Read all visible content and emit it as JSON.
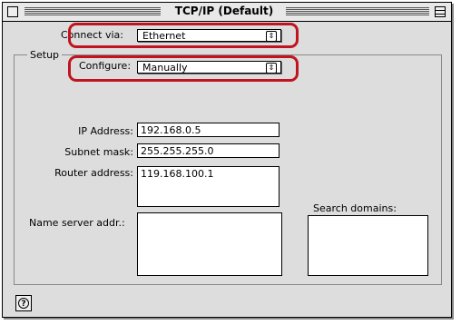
{
  "window": {
    "title": "TCP/IP (Default)"
  },
  "connect_via": {
    "label": "Connect via:",
    "value": "Ethernet"
  },
  "setup": {
    "group_label": "Setup",
    "configure": {
      "label": "Configure:",
      "value": "Manually"
    },
    "ip_address": {
      "label": "IP Address:",
      "value": "192.168.0.5"
    },
    "subnet_mask": {
      "label": "Subnet mask:",
      "value": "255.255.255.0"
    },
    "router_address": {
      "label": "Router address:",
      "value": "119.168.100.1"
    },
    "name_server": {
      "label": "Name server addr.:",
      "value": ""
    },
    "search_domains": {
      "label": "Search domains:",
      "value": ""
    }
  },
  "help": {
    "icon": "help-icon",
    "glyph": "?"
  },
  "colors": {
    "highlight": "#c0141f",
    "window_bg": "#dddddd"
  }
}
